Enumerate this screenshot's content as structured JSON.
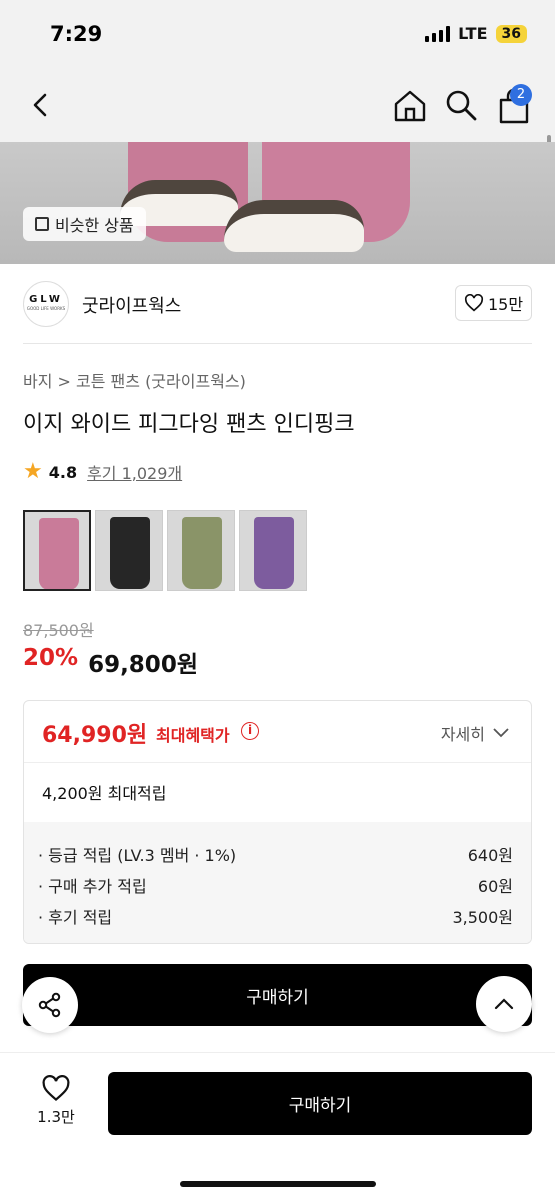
{
  "status_bar": {
    "time": "7:29",
    "network": "LTE",
    "battery": "36"
  },
  "nav": {
    "cart_count": "2"
  },
  "image": {
    "similar_label": "비슷한 상품"
  },
  "brand": {
    "logo_text": "GLW",
    "logo_sub": "GOOD LIFE WORKS",
    "name": "굿라이프웍스",
    "likes": "15만"
  },
  "product": {
    "breadcrumb": "바지 > 코튼 팬츠 (굿라이프웍스)",
    "title": "이지 와이드 피그다잉 팬츠 인디핑크",
    "rating": "4.8",
    "review_link": "후기 1,029개",
    "color_swatches": [
      {
        "name": "pink",
        "color": "#c97b99"
      },
      {
        "name": "black",
        "color": "#262626"
      },
      {
        "name": "khaki",
        "color": "#8a9468"
      },
      {
        "name": "purple",
        "color": "#7d5c9e"
      }
    ],
    "original_price": "87,500원",
    "discount": "20%",
    "sale_price": "69,800원"
  },
  "benefit": {
    "best_price": "64,990원",
    "best_label": "최대혜택가",
    "detail_toggle": "자세히",
    "points_max": "4,200원 최대적립",
    "points": [
      {
        "label": "· 등급 적립 (LV.3 멤버 · 1%)",
        "value": "640원"
      },
      {
        "label": "· 구매 추가 적립",
        "value": "60원"
      },
      {
        "label": "· 후기 적립",
        "value": "3,500원"
      }
    ]
  },
  "actions": {
    "buy_main": "구매하기",
    "wish_count": "1.3만",
    "buy_bottom": "구매하기"
  },
  "colors": {
    "accent_red": "#e02424",
    "badge_blue": "#2f6fe0",
    "button_black": "#000000"
  }
}
